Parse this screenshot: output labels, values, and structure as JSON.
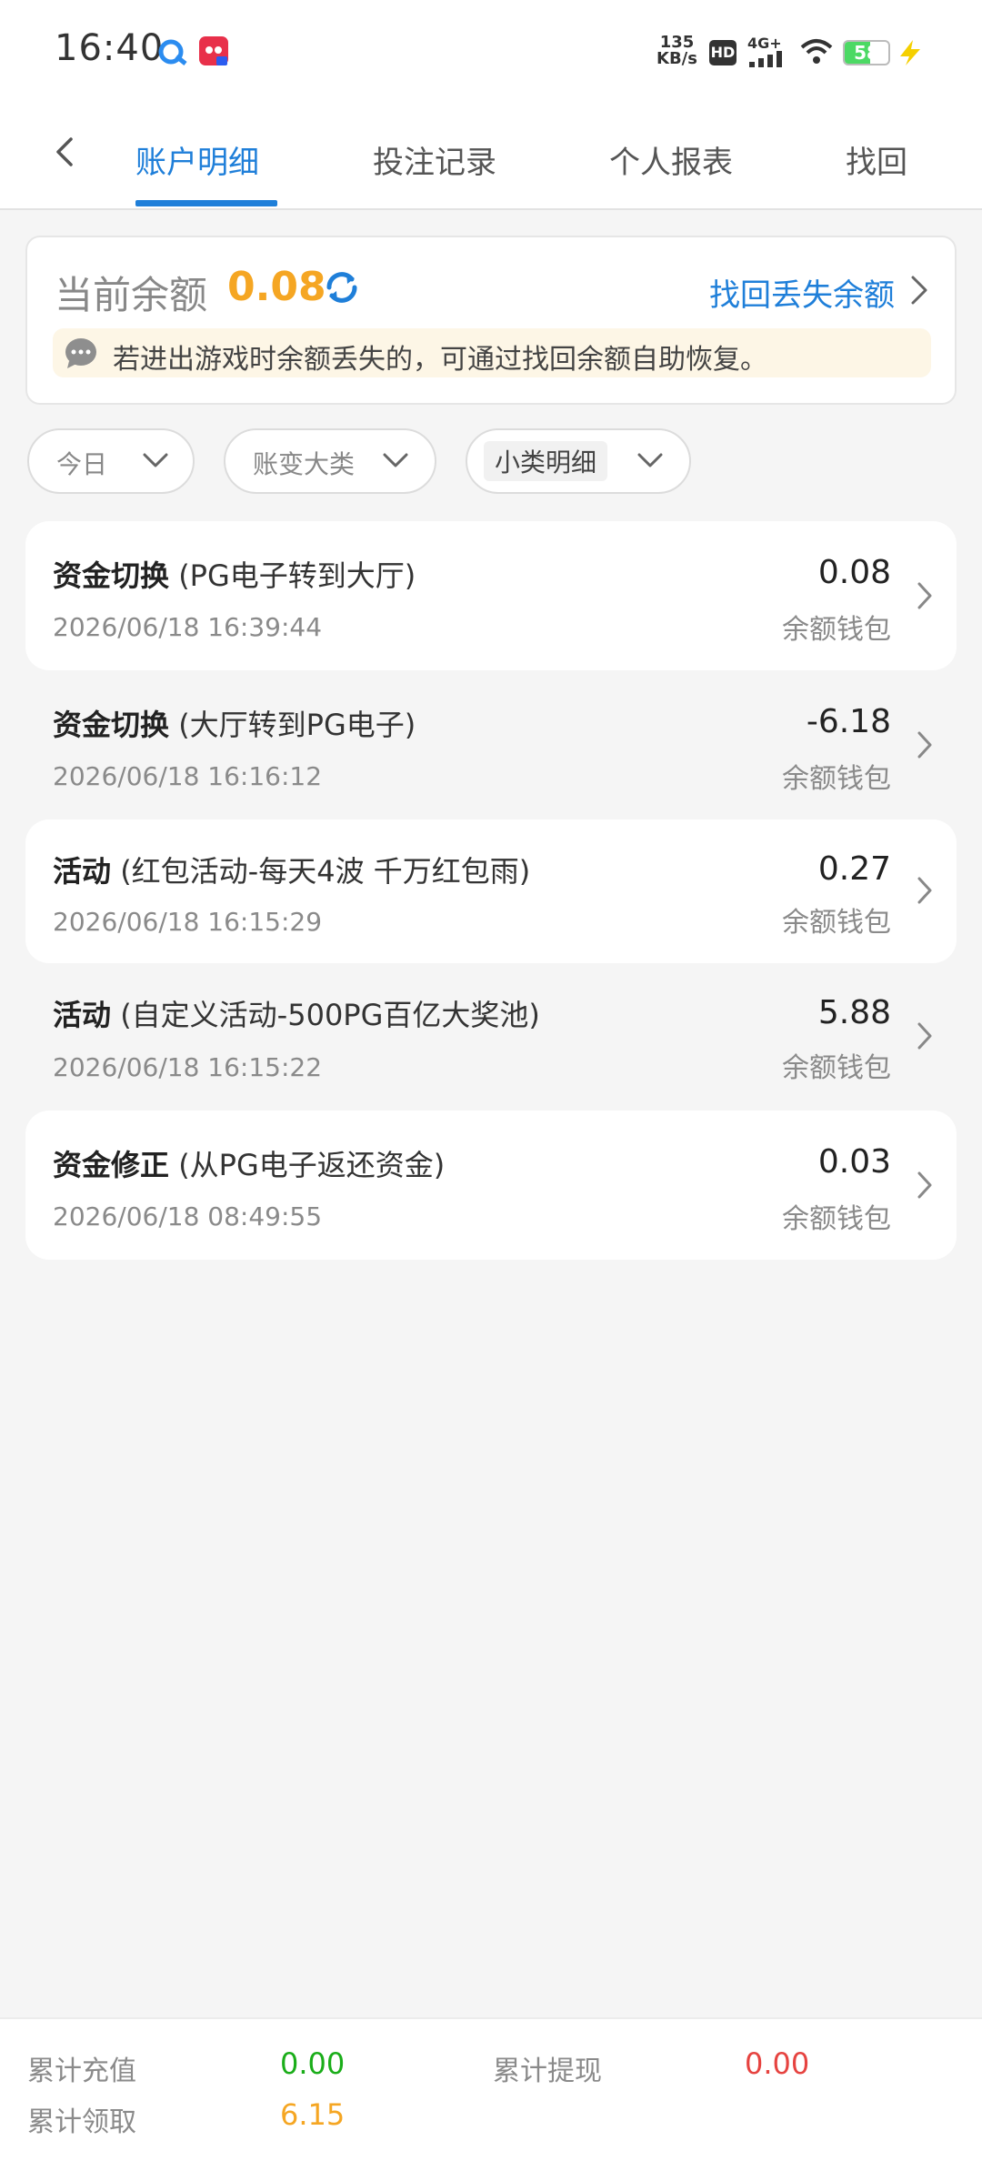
{
  "status_bar": {
    "time": "16:40",
    "speed_value": "135",
    "speed_unit": "KB/s",
    "hd": "HD",
    "network": "4G+",
    "battery": "58",
    "battery_level": 0.58
  },
  "tabs": [
    {
      "label": "账户明细",
      "active": true
    },
    {
      "label": "投注记录",
      "active": false
    },
    {
      "label": "个人报表",
      "active": false
    },
    {
      "label": "找回",
      "active": false
    }
  ],
  "balance": {
    "label": "当前余额",
    "value": "0.08",
    "recover_link": "找回丢失余额",
    "notice": "若进出游戏时余额丢失的，可通过找回余额自助恢复。"
  },
  "filters": [
    {
      "label": "今日"
    },
    {
      "label": "账变大类"
    },
    {
      "label": "小类明细"
    }
  ],
  "records": [
    {
      "type": "资金切换",
      "detail": "(PG电子转到大厅)",
      "time": "2026/06/18 16:39:44",
      "amount": "0.08",
      "wallet": "余额钱包"
    },
    {
      "type": "资金切换",
      "detail": "(大厅转到PG电子)",
      "time": "2026/06/18 16:16:12",
      "amount": "-6.18",
      "wallet": "余额钱包"
    },
    {
      "type": "活动",
      "detail": "(红包活动-每天4波 千万红包雨)",
      "time": "2026/06/18 16:15:29",
      "amount": "0.27",
      "wallet": "余额钱包"
    },
    {
      "type": "活动",
      "detail": "(自定义活动-500PG百亿大奖池)",
      "time": "2026/06/18 16:15:22",
      "amount": "5.88",
      "wallet": "余额钱包"
    },
    {
      "type": "资金修正",
      "detail": "(从PG电子返还资金)",
      "time": "2026/06/18 08:49:55",
      "amount": "0.03",
      "wallet": "余额钱包"
    }
  ],
  "summary": {
    "recharge_label": "累计充值",
    "recharge_value": "0.00",
    "withdraw_label": "累计提现",
    "withdraw_value": "0.00",
    "claimed_label": "累计领取",
    "claimed_value": "6.15"
  },
  "colors": {
    "accent": "#1f7fd9",
    "balance": "#f5a623",
    "recharge": "#1aad19",
    "withdraw": "#e64340",
    "claimed": "#f5a623"
  }
}
